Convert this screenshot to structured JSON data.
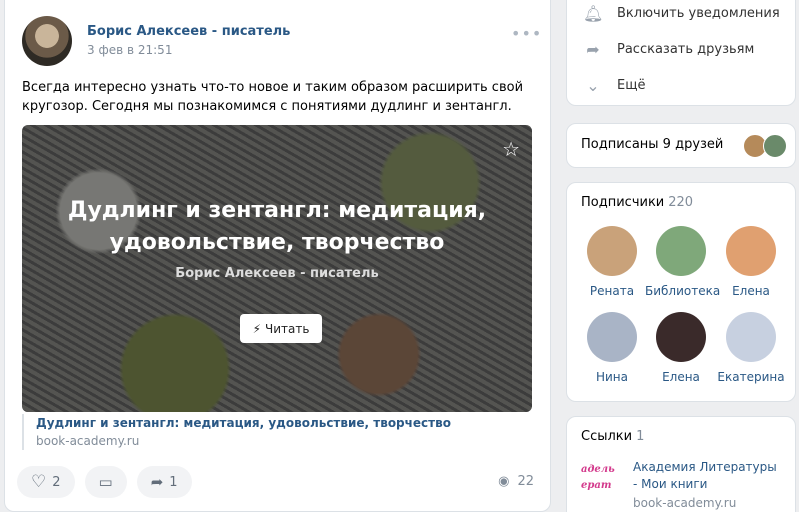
{
  "post": {
    "author": "Борис Алексеев - писатель",
    "date": "3 фев в 21:51",
    "more_icon": "•••",
    "text": "Всегда интересно узнать что-то новое и таким образом расширить свой кругозор. Сегодня мы познакомимся с понятиями дудлинг и зентангл.",
    "cover_title": "Дудлинг и зентангл: медитация, удовольствие, творчество",
    "cover_subtitle": "Борис Алексеев - писатель",
    "read_label": "Читать",
    "link_title": "Дудлинг и зентангл: медитация, удовольствие, творчество",
    "link_url": "book-academy.ru",
    "likes": "2",
    "reposts": "1",
    "views": "22"
  },
  "sidebar": {
    "menu": [
      {
        "label": "Включить уведомления",
        "icon": "bell-icon"
      },
      {
        "label": "Рассказать друзьям",
        "icon": "share-icon"
      },
      {
        "label": "Ещё",
        "icon": "chevron-down-icon"
      }
    ],
    "friends_label": "Подписаны 9 друзей",
    "subscribers_label": "Подписчики",
    "subscribers_count": "220",
    "subscribers": [
      {
        "name": "Рената",
        "color": "#c9a27a"
      },
      {
        "name": "Библиотека",
        "color": "#7fa87a"
      },
      {
        "name": "Елена",
        "color": "#e0a070"
      },
      {
        "name": "Нина",
        "color": "#a9b4c6"
      },
      {
        "name": "Елена",
        "color": "#3a2a2a"
      },
      {
        "name": "Екатерина",
        "color": "#c7d0e0"
      }
    ],
    "links_label": "Ссылки",
    "links_count": "1",
    "link_logo": "Академия Литературы",
    "link_name": "Академия Литературы - Мои книги",
    "link_url": "book-academy.ru"
  },
  "colors": {
    "accent": "#2a5885",
    "muted": "#818c99"
  }
}
